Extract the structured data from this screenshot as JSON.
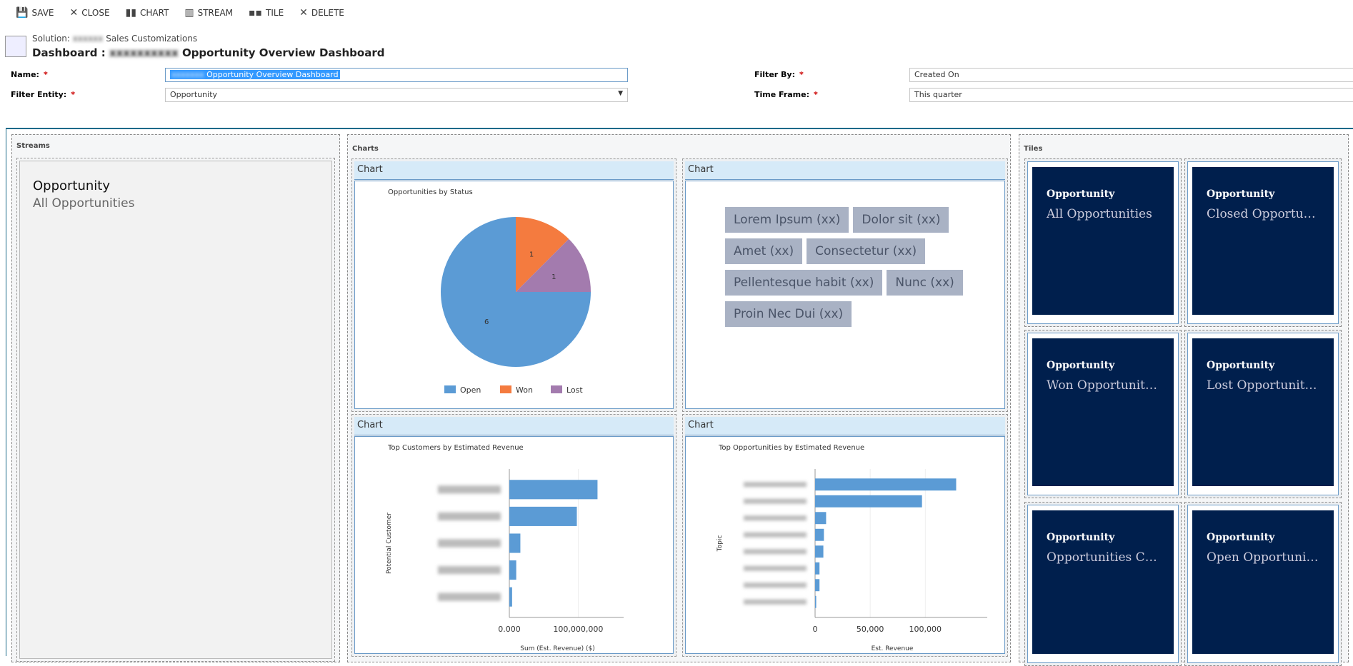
{
  "toolbar": {
    "save": "SAVE",
    "close": "CLOSE",
    "chart": "CHART",
    "stream": "STREAM",
    "tile": "TILE",
    "delete": "DELETE"
  },
  "header": {
    "solution_prefix": "Solution:",
    "solution_name": "Sales Customizations",
    "title_prefix": "Dashboard :",
    "title": "Opportunity Overview Dashboard"
  },
  "form": {
    "name_label": "Name:",
    "name_value": "Opportunity Overview Dashboard",
    "filter_entity_label": "Filter Entity:",
    "filter_entity_value": "Opportunity",
    "filter_by_label": "Filter By:",
    "filter_by_value": "Created On",
    "time_frame_label": "Time Frame:",
    "time_frame_value": "This quarter",
    "required": "*"
  },
  "streams": {
    "title": "Streams",
    "entity": "Opportunity",
    "view": "All Opportunities"
  },
  "charts": {
    "title": "Charts",
    "cell_header": "Chart",
    "tags": [
      "Lorem Ipsum (xx)",
      "Dolor sit (xx)",
      "Amet (xx)",
      "Consectetur  (xx)",
      "Pellentesque habit   (xx)",
      "Nunc (xx)",
      "Proin Nec Dui (xx)"
    ]
  },
  "chart_data": [
    {
      "type": "pie",
      "title": "Opportunities by Status",
      "categories": [
        "Open",
        "Won",
        "Lost"
      ],
      "values": [
        6,
        1,
        1
      ],
      "colors": [
        "#5b9bd5",
        "#f47b3f",
        "#a37bae"
      ],
      "legend": "bottom"
    },
    {
      "type": "bar",
      "orientation": "horizontal",
      "title": "Top Customers by Estimated Revenue",
      "ylabel": "Potential Customer",
      "xlabel": "Sum (Est. Revenue) ($)",
      "ticks": [
        "0.000",
        "100,000,000"
      ],
      "tick_values": [
        0,
        100000000
      ],
      "xlim": [
        0,
        140000000
      ],
      "values": [
        128000000,
        98000000,
        16000000,
        10000000,
        4000000
      ],
      "color": "#5b9bd5"
    },
    {
      "type": "bar",
      "orientation": "horizontal",
      "title": "Top Opportunities by Estimated Revenue",
      "ylabel": "Topic",
      "xlabel": "Est. Revenue",
      "ticks": [
        "0",
        "50,000",
        "100,000"
      ],
      "tick_values": [
        0,
        50000,
        100000
      ],
      "xlim": [
        0,
        140000
      ],
      "values": [
        128000,
        97000,
        10000,
        8000,
        7500,
        4000,
        4000,
        1000
      ],
      "color": "#5b9bd5"
    }
  ],
  "tiles": {
    "title": "Tiles",
    "items": [
      {
        "entity": "Opportunity",
        "view": "All Opportunities"
      },
      {
        "entity": "Opportunity",
        "view": "Closed Opportunities"
      },
      {
        "entity": "Opportunity",
        "view": "Won Opportunities"
      },
      {
        "entity": "Opportunity",
        "view": "Lost Opportunities"
      },
      {
        "entity": "Opportunity",
        "view": "Opportunities Closing Next Month"
      },
      {
        "entity": "Opportunity",
        "view": "Open Opportunities"
      }
    ]
  },
  "colors": {
    "accent": "#1b6a8a",
    "tile": "#001f4d",
    "header": "#d6eaf8"
  }
}
